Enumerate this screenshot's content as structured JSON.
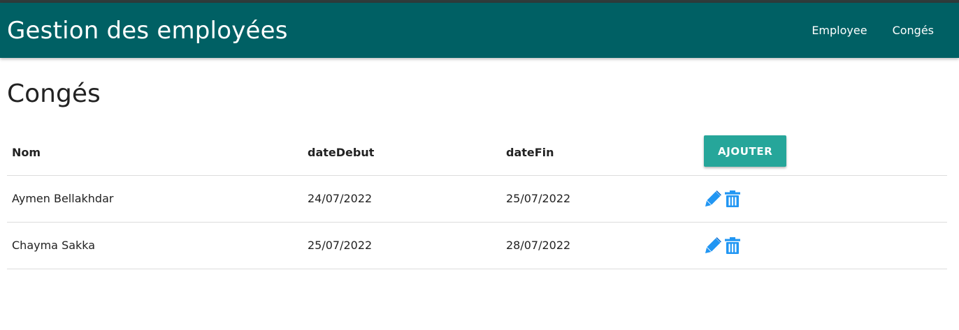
{
  "navbar": {
    "brand": "Gestion des employées",
    "links": [
      "Employee",
      "Congés"
    ]
  },
  "page": {
    "title": "Congés"
  },
  "table": {
    "headers": [
      "Nom",
      "dateDebut",
      "dateFin"
    ],
    "add_label": "AJOUTER",
    "rows": [
      {
        "nom": "Aymen Bellakhdar",
        "dateDebut": "24/07/2022",
        "dateFin": "25/07/2022"
      },
      {
        "nom": "Chayma Sakka",
        "dateDebut": "25/07/2022",
        "dateFin": "28/07/2022"
      }
    ]
  },
  "icons": {
    "edit": "pencil-icon",
    "delete": "trash-icon"
  },
  "colors": {
    "navbar": "#006064",
    "button": "#26a69a",
    "icon": "#2196f3"
  }
}
